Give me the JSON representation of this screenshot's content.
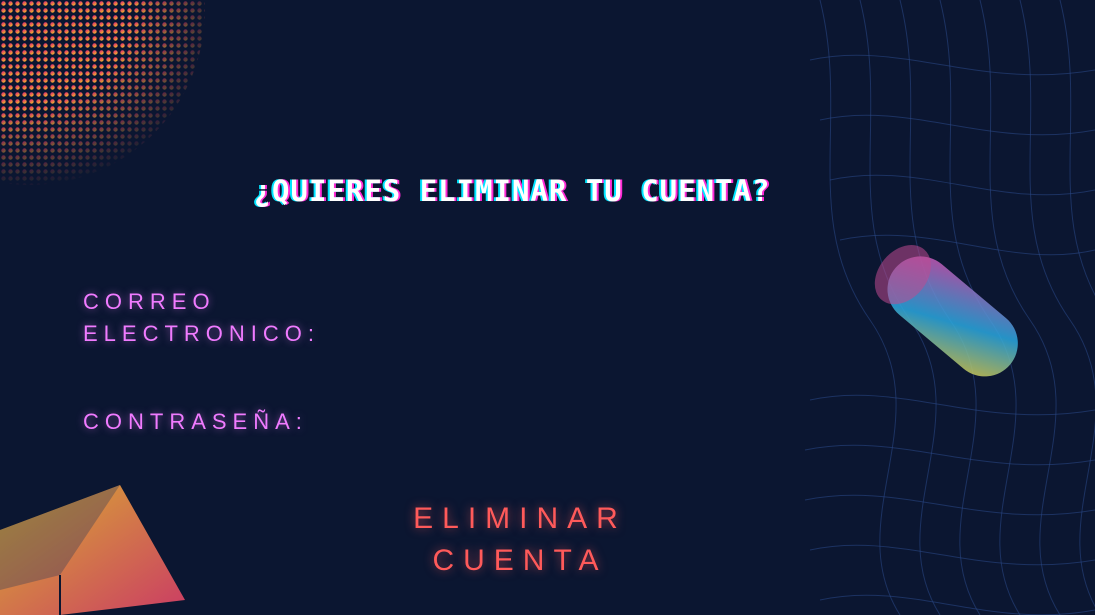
{
  "title": "¿QUIERES ELIMINAR TU CUENTA?",
  "form": {
    "email_label_line1": "CORREO",
    "email_label_line2": "ELECTRONICO:",
    "email_value": "",
    "password_label": "CONTRASEÑA:",
    "password_value": ""
  },
  "action": {
    "delete_line1": "ELIMINAR",
    "delete_line2": "CUENTA"
  },
  "colors": {
    "background": "#0b1631",
    "label": "#f07bff",
    "button": "#ff5a5a",
    "title": "#ffffff"
  }
}
